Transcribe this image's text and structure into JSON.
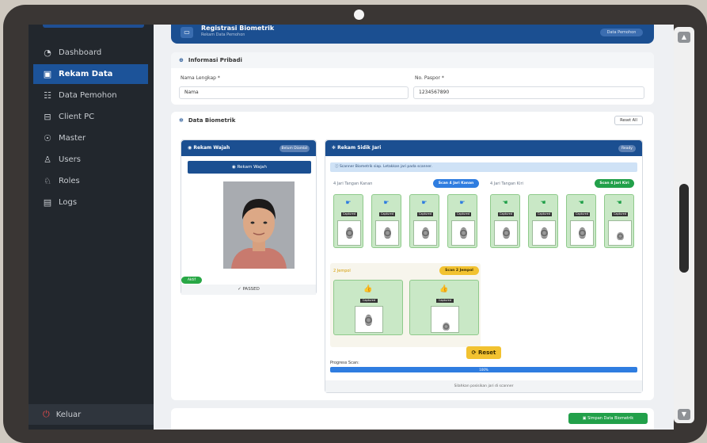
{
  "sidebar": {
    "items": [
      {
        "label": "Dashboard",
        "icon": "dashboard-icon"
      },
      {
        "label": "Rekam Data",
        "icon": "record-icon",
        "active": true
      },
      {
        "label": "Data Pemohon",
        "icon": "applicants-icon"
      },
      {
        "label": "Client PC",
        "icon": "client-pc-icon"
      },
      {
        "label": "Master",
        "icon": "master-icon"
      },
      {
        "label": "Users",
        "icon": "users-icon"
      },
      {
        "label": "Roles",
        "icon": "roles-icon"
      },
      {
        "label": "Logs",
        "icon": "logs-icon"
      }
    ],
    "logout": "Keluar"
  },
  "header": {
    "title": "Registrasi Biometrik",
    "subtitle": "Rekam Data Pemohon",
    "button": "Data Pemohon"
  },
  "personal": {
    "section_title": "Informasi Pribadi",
    "name_label": "Nama Lengkap *",
    "name_value": "Nama",
    "passport_label": "No. Paspor *",
    "passport_value": "1234567890"
  },
  "biometric": {
    "section_title": "Data Biometrik",
    "reset_all": "Reset All"
  },
  "face": {
    "title": "Rekam Wajah",
    "badge": "Belum Diambil",
    "capture_button": "Rekam Wajah",
    "status_pill": "Aktif",
    "result": "✓ PASSED"
  },
  "fingers": {
    "title": "Rekam Sidik Jari",
    "badge": "Ready",
    "info": "Scanner Biometrik siap. Letakkan jari pada scanner.",
    "right_hand": {
      "title": "4 Jari Tangan Kanan",
      "scan": "Scan 4 Jari Kanan"
    },
    "left_hand": {
      "title": "4 Jari Tangan Kiri",
      "scan": "Scan 4 Jari Kiri"
    },
    "thumbs": {
      "title": "2 Jempol",
      "scan": "Scan 2 Jempol"
    },
    "captured_tag": "Captured",
    "reset_button": "Reset",
    "progress_label": "Progress Scan:",
    "progress_value": "100%",
    "progress_fraction": 1.0,
    "footer_note": "Silahkan posisikan jari di scanner"
  },
  "save_button": "Simpan Data Biometrik"
}
